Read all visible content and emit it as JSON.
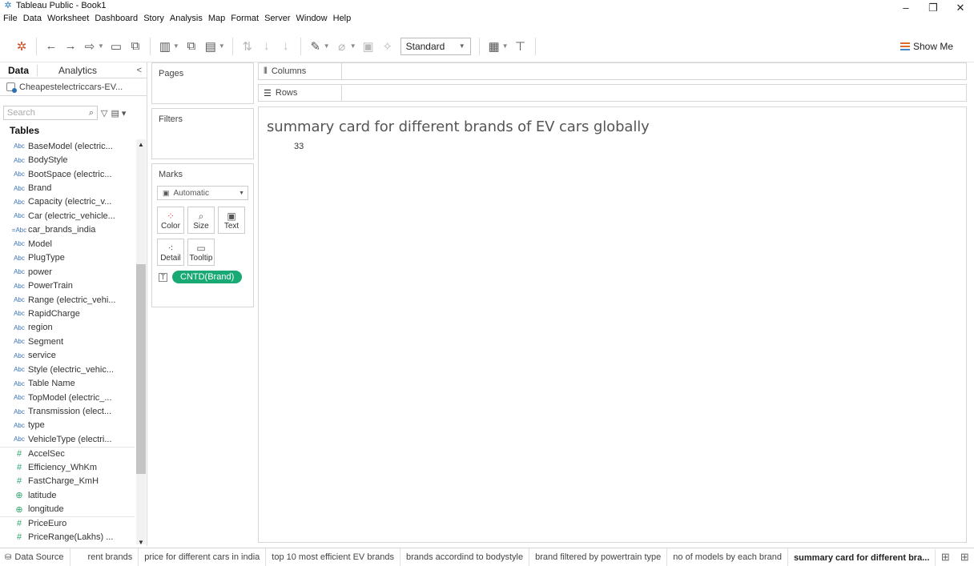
{
  "window": {
    "title": "Tableau Public - Book1",
    "controls": [
      "–",
      "❐",
      "✕"
    ]
  },
  "menu": [
    "File",
    "Data",
    "Worksheet",
    "Dashboard",
    "Story",
    "Analysis",
    "Map",
    "Format",
    "Server",
    "Window",
    "Help"
  ],
  "toolbar": {
    "fit_dropdown": "Standard",
    "show_me_label": "Show Me"
  },
  "data_pane": {
    "tab_data": "Data",
    "tab_analytics": "Analytics",
    "collapse_glyph": "<",
    "source_name": "Cheapestelectriccars-EV...",
    "search_placeholder": "Search",
    "tables_title": "Tables",
    "fields": [
      {
        "type": "Abc",
        "name": "BaseModel (electric..."
      },
      {
        "type": "Abc",
        "name": "BodyStyle"
      },
      {
        "type": "Abc",
        "name": "BootSpace (electric..."
      },
      {
        "type": "Abc",
        "name": "Brand"
      },
      {
        "type": "Abc",
        "name": "Capacity (electric_v..."
      },
      {
        "type": "Abc",
        "name": "Car (electric_vehicle..."
      },
      {
        "type": "=Abc",
        "name": "car_brands_india"
      },
      {
        "type": "Abc",
        "name": "Model"
      },
      {
        "type": "Abc",
        "name": "PlugType"
      },
      {
        "type": "Abc",
        "name": "power"
      },
      {
        "type": "Abc",
        "name": "PowerTrain"
      },
      {
        "type": "Abc",
        "name": "Range (electric_vehi..."
      },
      {
        "type": "Abc",
        "name": "RapidCharge"
      },
      {
        "type": "Abc",
        "name": "region"
      },
      {
        "type": "Abc",
        "name": "Segment"
      },
      {
        "type": "Abc",
        "name": "service"
      },
      {
        "type": "Abc",
        "name": "Style (electric_vehic..."
      },
      {
        "type": "Abc",
        "name": "Table Name"
      },
      {
        "type": "Abc",
        "name": "TopModel (electric_..."
      },
      {
        "type": "Abc",
        "name": "Transmission (elect..."
      },
      {
        "type": "Abc",
        "name": "type"
      },
      {
        "type": "Abc",
        "name": "VehicleType (electri..."
      },
      {
        "type": "#",
        "name": "AccelSec"
      },
      {
        "type": "#",
        "name": "Efficiency_WhKm"
      },
      {
        "type": "#",
        "name": "FastCharge_KmH"
      },
      {
        "type": "geo",
        "name": "latitude"
      },
      {
        "type": "geo",
        "name": "longitude"
      },
      {
        "type": "#",
        "name": "PriceEuro"
      },
      {
        "type": "#",
        "name": "PriceRange(Lakhs) ..."
      }
    ]
  },
  "cards": {
    "pages": "Pages",
    "filters": "Filters",
    "marks": "Marks",
    "mark_type": "Automatic",
    "mark_buttons": [
      {
        "label": "Color",
        "icon": "color-icon"
      },
      {
        "label": "Size",
        "icon": "size-icon"
      },
      {
        "label": "Text",
        "icon": "text-icon"
      },
      {
        "label": "Detail",
        "icon": "detail-icon"
      },
      {
        "label": "Tooltip",
        "icon": "tooltip-icon"
      }
    ],
    "mark_pill": "CNTD(Brand)"
  },
  "shelves": {
    "columns": "Columns",
    "rows": "Rows"
  },
  "viz": {
    "title": "summary card for different brands of EV cars globally",
    "value": "33"
  },
  "sheet_tabs": {
    "data_source": "Data Source",
    "sheets": [
      "rent brands",
      "price for different cars in india",
      "top 10 most efficient EV brands",
      "brands accordind to bodystyle",
      "brand filtered by powertrain type",
      "no of models by each brand",
      "summary card for different bra..."
    ],
    "active_index": 6
  }
}
